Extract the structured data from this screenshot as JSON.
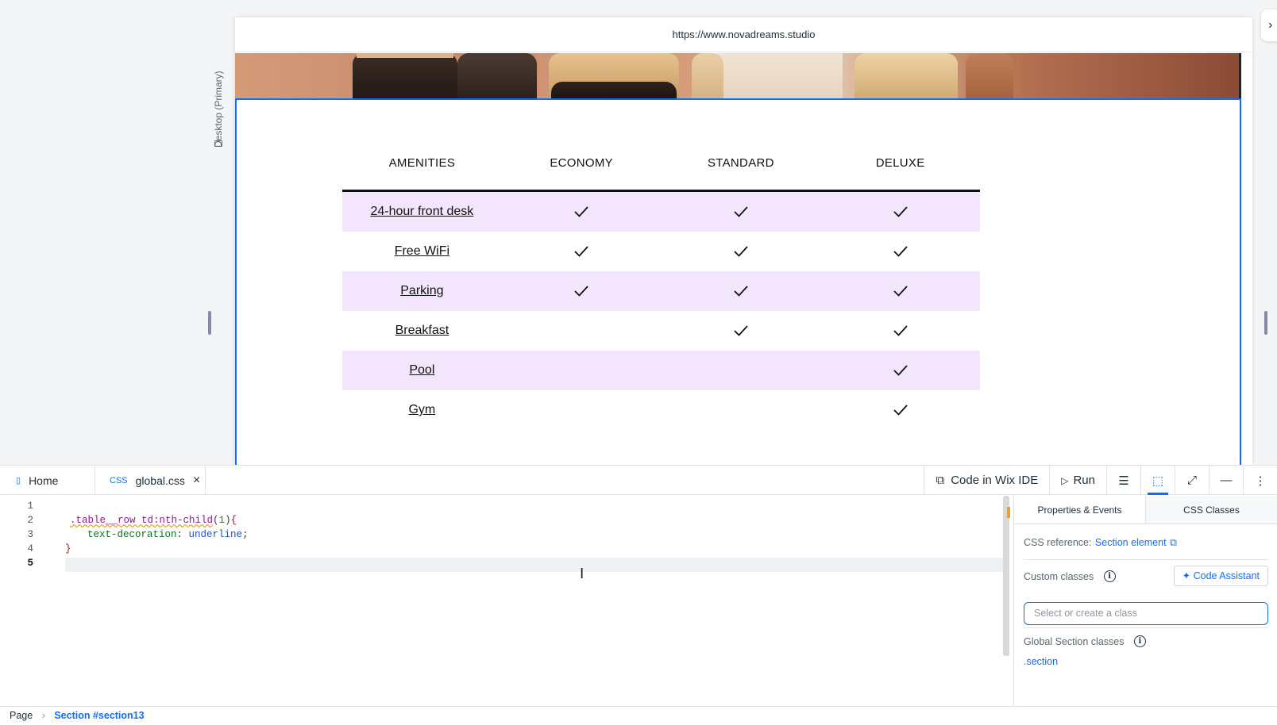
{
  "canvas": {
    "device_label": "Desktop (Primary)",
    "url": "https://www.novadreams.studio"
  },
  "table": {
    "headers": [
      "AMENITIES",
      "ECONOMY",
      "STANDARD",
      "DELUXE"
    ],
    "rows": [
      {
        "amenity": "24-hour front desk",
        "economy": true,
        "standard": true,
        "deluxe": true
      },
      {
        "amenity": "Free WiFi",
        "economy": true,
        "standard": true,
        "deluxe": true
      },
      {
        "amenity": "Parking",
        "economy": true,
        "standard": true,
        "deluxe": true
      },
      {
        "amenity": "Breakfast",
        "economy": false,
        "standard": true,
        "deluxe": true
      },
      {
        "amenity": "Pool",
        "economy": false,
        "standard": false,
        "deluxe": true
      },
      {
        "amenity": "Gym",
        "economy": false,
        "standard": false,
        "deluxe": true
      }
    ],
    "row_shade_color": "#f3e5fb"
  },
  "panel": {
    "tabs": [
      {
        "label": "Home",
        "icon": "page-icon"
      },
      {
        "label": "global.css",
        "icon": "css-file-icon",
        "badge": "CSS"
      }
    ],
    "toolbar": {
      "code_in_ide": "Code in Wix IDE",
      "run": "Run"
    },
    "editor": {
      "line_numbers": [
        "1",
        "2",
        "3",
        "4",
        "5"
      ],
      "code": {
        "selector": ".table__row td:nth-child",
        "arg_open": "(",
        "arg": "1",
        "arg_close": ")",
        "open_brace": "{",
        "property": "text-decoration",
        "value": "underline",
        "close_brace": "}"
      },
      "current_line": "5"
    },
    "properties": {
      "tabs": [
        "Properties & Events",
        "CSS Classes"
      ],
      "css_reference_label": "CSS reference:",
      "css_reference_link": "Section element",
      "custom_classes_label": "Custom classes",
      "code_assistant": "Code Assistant",
      "class_input_placeholder": "Select or create a class",
      "global_classes_label": "Global Section classes",
      "global_class": ".section"
    },
    "status_bar": {
      "breadcrumb": [
        "Page",
        "Section #section13"
      ]
    }
  },
  "colors": {
    "accent": "#116dff",
    "selection_outline": "#116dff"
  }
}
